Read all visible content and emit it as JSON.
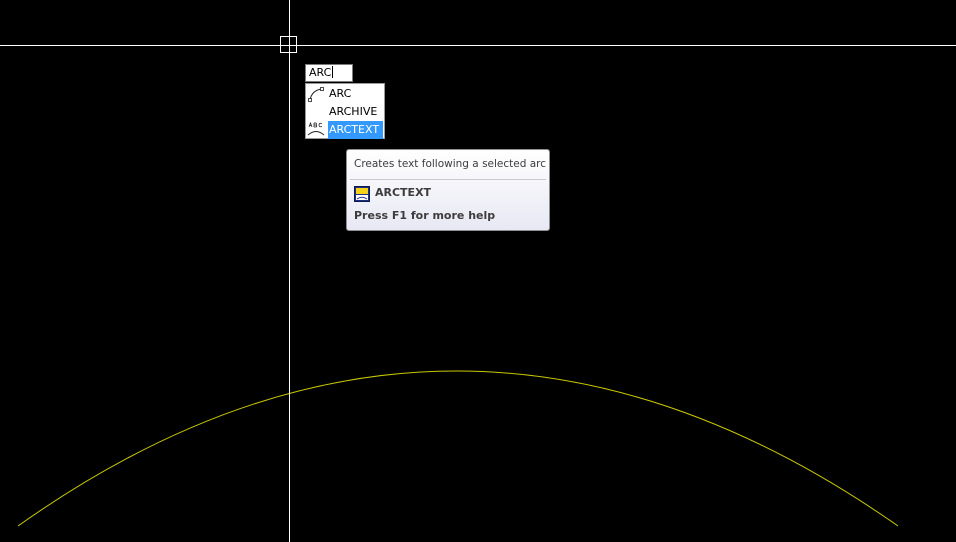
{
  "command_line": {
    "typed_text": "ARC"
  },
  "autocomplete": {
    "items": [
      {
        "label": "ARC",
        "icon": "arc-icon",
        "selected": false
      },
      {
        "label": "ARCHIVE",
        "icon": "",
        "selected": false
      },
      {
        "label": "ARCTEXT",
        "icon": "arctext-icon",
        "selected": true
      }
    ]
  },
  "tooltip": {
    "description": "Creates text following a selected arc",
    "command_name": "ARCTEXT",
    "help_hint": "Press F1 for more help",
    "icon": "arctext-command-icon"
  },
  "colors": {
    "background": "#000000",
    "crosshair": "#ffffff",
    "arc_stroke": "#c8c800",
    "selection_highlight": "#3399ff"
  }
}
